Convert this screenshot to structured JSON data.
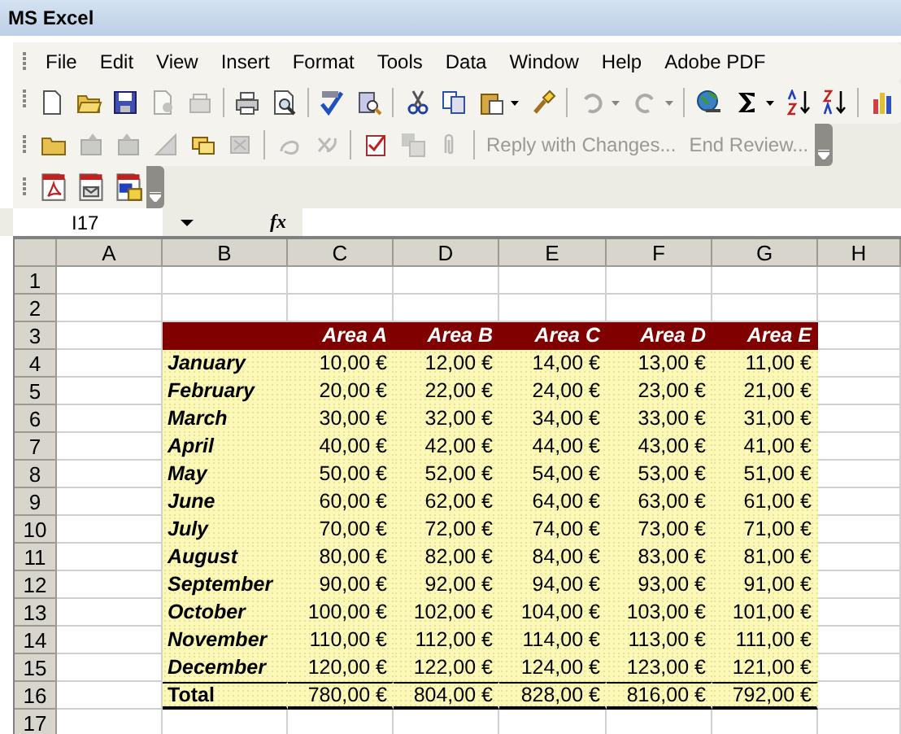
{
  "window": {
    "title": "MS Excel"
  },
  "menu": [
    "File",
    "Edit",
    "View",
    "Insert",
    "Format",
    "Tools",
    "Data",
    "Window",
    "Help",
    "Adobe PDF"
  ],
  "standard_toolbar": [
    {
      "kind": "button",
      "disabled": false
    },
    {
      "kind": "button",
      "disabled": false
    },
    {
      "kind": "button",
      "disabled": false
    },
    {
      "kind": "button",
      "disabled": true
    },
    {
      "kind": "button",
      "disabled": true
    },
    {
      "kind": "separator"
    },
    {
      "kind": "button",
      "disabled": false
    },
    {
      "kind": "button",
      "disabled": false
    },
    {
      "kind": "separator"
    },
    {
      "kind": "button",
      "disabled": false
    },
    {
      "kind": "button",
      "disabled": false
    },
    {
      "kind": "separator"
    },
    {
      "kind": "button",
      "disabled": false
    },
    {
      "kind": "button",
      "disabled": false
    },
    {
      "kind": "split",
      "disabled": false
    },
    {
      "kind": "button",
      "disabled": false
    },
    {
      "kind": "separator"
    },
    {
      "kind": "split",
      "disabled": true
    },
    {
      "kind": "split",
      "disabled": true
    },
    {
      "kind": "separator"
    },
    {
      "kind": "button",
      "disabled": false
    },
    {
      "kind": "split",
      "disabled": false
    },
    {
      "kind": "button",
      "disabled": false
    },
    {
      "kind": "button",
      "disabled": false
    },
    {
      "kind": "separator"
    },
    {
      "kind": "button",
      "disabled": false
    }
  ],
  "review_toolbar": [
    {
      "kind": "button",
      "disabled": false
    },
    {
      "kind": "button",
      "disabled": true
    },
    {
      "kind": "button",
      "disabled": true
    },
    {
      "kind": "button",
      "disabled": true
    },
    {
      "kind": "button",
      "disabled": false
    },
    {
      "kind": "button",
      "disabled": true
    },
    {
      "kind": "separator"
    },
    {
      "kind": "button",
      "disabled": true
    },
    {
      "kind": "button",
      "disabled": true
    },
    {
      "kind": "separator"
    },
    {
      "kind": "button",
      "disabled": false
    },
    {
      "kind": "button",
      "disabled": true
    },
    {
      "kind": "button",
      "disabled": true
    },
    {
      "kind": "separator"
    },
    {
      "kind": "text",
      "label": "Reply with Changes...",
      "disabled": true
    },
    {
      "kind": "text",
      "label": "End Review...",
      "disabled": true
    }
  ],
  "pdf_toolbar": [
    {
      "kind": "button",
      "disabled": false
    },
    {
      "kind": "button",
      "disabled": false
    },
    {
      "kind": "button",
      "disabled": false
    }
  ],
  "formula_bar": {
    "name_box": "I17",
    "fx": "fx"
  },
  "columns": [
    "A",
    "B",
    "C",
    "D",
    "E",
    "F",
    "G",
    "H"
  ],
  "rows": [
    {
      "number": "1",
      "kind": "empty"
    },
    {
      "number": "2",
      "kind": "empty"
    },
    {
      "number": "3",
      "kind": "header",
      "values": [
        "Area A",
        "Area B",
        "Area C",
        "Area D",
        "Area E"
      ]
    },
    {
      "number": "4",
      "kind": "data",
      "label": "January",
      "values": [
        "10,00 €",
        "12,00 €",
        "14,00 €",
        "13,00 €",
        "11,00 €"
      ]
    },
    {
      "number": "5",
      "kind": "data",
      "label": "February",
      "values": [
        "20,00 €",
        "22,00 €",
        "24,00 €",
        "23,00 €",
        "21,00 €"
      ]
    },
    {
      "number": "6",
      "kind": "data",
      "label": "March",
      "values": [
        "30,00 €",
        "32,00 €",
        "34,00 €",
        "33,00 €",
        "31,00 €"
      ]
    },
    {
      "number": "7",
      "kind": "data",
      "label": "April",
      "values": [
        "40,00 €",
        "42,00 €",
        "44,00 €",
        "43,00 €",
        "41,00 €"
      ]
    },
    {
      "number": "8",
      "kind": "data",
      "label": "May",
      "values": [
        "50,00 €",
        "52,00 €",
        "54,00 €",
        "53,00 €",
        "51,00 €"
      ]
    },
    {
      "number": "9",
      "kind": "data",
      "label": "June",
      "values": [
        "60,00 €",
        "62,00 €",
        "64,00 €",
        "63,00 €",
        "61,00 €"
      ]
    },
    {
      "number": "10",
      "kind": "data",
      "label": "July",
      "values": [
        "70,00 €",
        "72,00 €",
        "74,00 €",
        "73,00 €",
        "71,00 €"
      ]
    },
    {
      "number": "11",
      "kind": "data",
      "label": "August",
      "values": [
        "80,00 €",
        "82,00 €",
        "84,00 €",
        "83,00 €",
        "81,00 €"
      ]
    },
    {
      "number": "12",
      "kind": "data",
      "label": "September",
      "values": [
        "90,00 €",
        "92,00 €",
        "94,00 €",
        "93,00 €",
        "91,00 €"
      ]
    },
    {
      "number": "13",
      "kind": "data",
      "label": "October",
      "values": [
        "100,00 €",
        "102,00 €",
        "104,00 €",
        "103,00 €",
        "101,00 €"
      ]
    },
    {
      "number": "14",
      "kind": "data",
      "label": "November",
      "values": [
        "110,00 €",
        "112,00 €",
        "114,00 €",
        "113,00 €",
        "111,00 €"
      ]
    },
    {
      "number": "15",
      "kind": "data",
      "label": "December",
      "values": [
        "120,00 €",
        "122,00 €",
        "124,00 €",
        "123,00 €",
        "121,00 €"
      ]
    },
    {
      "number": "16",
      "kind": "total",
      "label": "Total",
      "values": [
        "780,00 €",
        "804,00 €",
        "828,00 €",
        "816,00 €",
        "792,00 €"
      ]
    },
    {
      "number": "17",
      "kind": "empty"
    }
  ]
}
